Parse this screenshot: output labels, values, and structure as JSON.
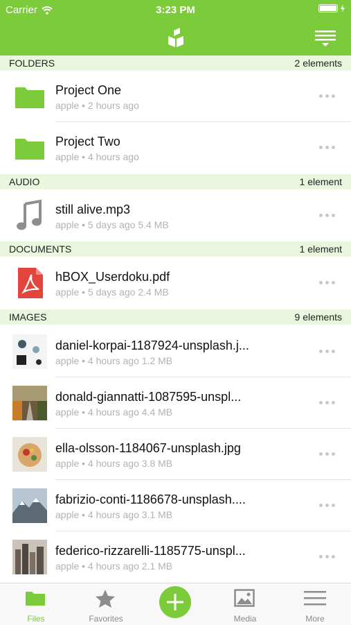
{
  "status": {
    "carrier": "Carrier",
    "time": "3:23 PM"
  },
  "sections": [
    {
      "name": "FOLDERS",
      "count": "2 elements"
    },
    {
      "name": "AUDIO",
      "count": "1 element"
    },
    {
      "name": "DOCUMENTS",
      "count": "1 element"
    },
    {
      "name": "IMAGES",
      "count": "9 elements"
    }
  ],
  "folders": [
    {
      "title": "Project One",
      "meta": "apple • 2 hours ago"
    },
    {
      "title": "Project Two",
      "meta": "apple • 4 hours ago"
    }
  ],
  "audio": [
    {
      "title": "still alive.mp3",
      "meta": "apple • 5 days ago 5.4 MB"
    }
  ],
  "documents": [
    {
      "title": "hBOX_Userdoku.pdf",
      "meta": "apple • 5 days ago 2.4 MB"
    }
  ],
  "images": [
    {
      "title": "daniel-korpai-1187924-unsplash.j...",
      "meta": "apple • 4 hours ago 1.2 MB"
    },
    {
      "title": "donald-giannatti-1087595-unspl...",
      "meta": "apple • 4 hours ago 4.4 MB"
    },
    {
      "title": "ella-olsson-1184067-unsplash.jpg",
      "meta": "apple • 4 hours ago 3.8 MB"
    },
    {
      "title": "fabrizio-conti-1186678-unsplash....",
      "meta": "apple • 4 hours ago 3.1 MB"
    },
    {
      "title": "federico-rizzarelli-1185775-unspl...",
      "meta": "apple • 4 hours ago 2.1 MB"
    }
  ],
  "tabs": [
    {
      "label": "Files",
      "icon": "folder-icon"
    },
    {
      "label": "Favorites",
      "icon": "star-icon"
    },
    {
      "label": "Media",
      "icon": "image-icon"
    },
    {
      "label": "More",
      "icon": "menu-icon"
    }
  ],
  "colors": {
    "brand": "#7ccb3a",
    "section_bg": "#eaf6dd",
    "pdf_red": "#e2453c"
  }
}
